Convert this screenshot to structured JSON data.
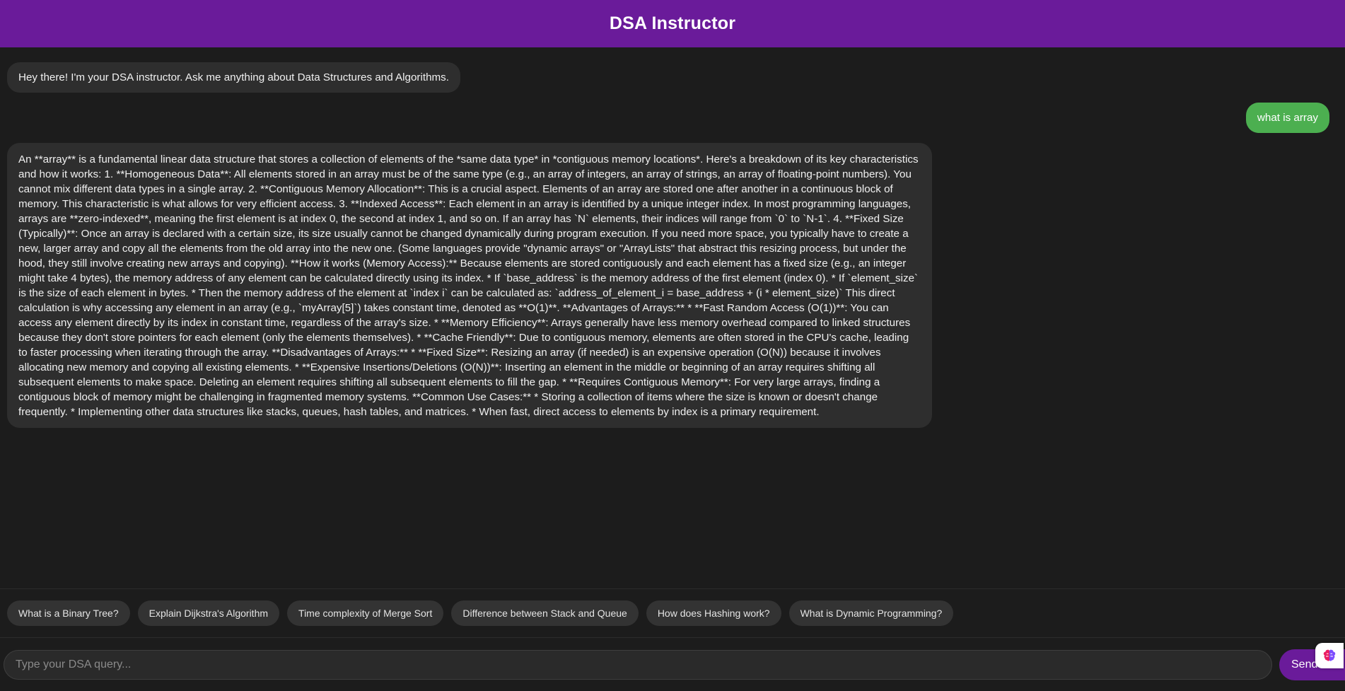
{
  "header": {
    "title": "DSA Instructor"
  },
  "messages": {
    "greeting": "Hey there! I'm your DSA instructor. Ask me anything about Data Structures and Algorithms.",
    "user_query": "what is array",
    "answer": "An **array** is a fundamental linear data structure that stores a collection of elements of the *same data type* in *contiguous memory locations*. Here's a breakdown of its key characteristics and how it works: 1. **Homogeneous Data**: All elements stored in an array must be of the same type (e.g., an array of integers, an array of strings, an array of floating-point numbers). You cannot mix different data types in a single array. 2. **Contiguous Memory Allocation**: This is a crucial aspect. Elements of an array are stored one after another in a continuous block of memory. This characteristic is what allows for very efficient access. 3. **Indexed Access**: Each element in an array is identified by a unique integer index. In most programming languages, arrays are **zero-indexed**, meaning the first element is at index 0, the second at index 1, and so on. If an array has `N` elements, their indices will range from `0` to `N-1`. 4. **Fixed Size (Typically)**: Once an array is declared with a certain size, its size usually cannot be changed dynamically during program execution. If you need more space, you typically have to create a new, larger array and copy all the elements from the old array into the new one. (Some languages provide \"dynamic arrays\" or \"ArrayLists\" that abstract this resizing process, but under the hood, they still involve creating new arrays and copying). **How it works (Memory Access):** Because elements are stored contiguously and each element has a fixed size (e.g., an integer might take 4 bytes), the memory address of any element can be calculated directly using its index. * If `base_address` is the memory address of the first element (index 0). * If `element_size` is the size of each element in bytes. * Then the memory address of the element at `index i` can be calculated as: `address_of_element_i = base_address + (i * element_size)` This direct calculation is why accessing any element in an array (e.g., `myArray[5]`) takes constant time, denoted as **O(1)**. **Advantages of Arrays:** * **Fast Random Access (O(1))**: You can access any element directly by its index in constant time, regardless of the array's size. * **Memory Efficiency**: Arrays generally have less memory overhead compared to linked structures because they don't store pointers for each element (only the elements themselves). * **Cache Friendly**: Due to contiguous memory, elements are often stored in the CPU's cache, leading to faster processing when iterating through the array. **Disadvantages of Arrays:** * **Fixed Size**: Resizing an array (if needed) is an expensive operation (O(N)) because it involves allocating new memory and copying all existing elements. * **Expensive Insertions/Deletions (O(N))**: Inserting an element in the middle or beginning of an array requires shifting all subsequent elements to make space. Deleting an element requires shifting all subsequent elements to fill the gap. * **Requires Contiguous Memory**: For very large arrays, finding a contiguous block of memory might be challenging in fragmented memory systems. **Common Use Cases:** * Storing a collection of items where the size is known or doesn't change frequently. * Implementing other data structures like stacks, queues, hash tables, and matrices. * When fast, direct access to elements by index is a primary requirement."
  },
  "suggestions": [
    "What is a Binary Tree?",
    "Explain Dijkstra's Algorithm",
    "Time complexity of Merge Sort",
    "Difference between Stack and Queue",
    "How does Hashing work?",
    "What is Dynamic Programming?"
  ],
  "input": {
    "placeholder": "Type your DSA query...",
    "value": ""
  },
  "send_button": {
    "label": "Send"
  },
  "colors": {
    "header": "#6a1b9a",
    "user_bubble": "#4caf50",
    "bot_bubble": "#2e2e2e",
    "background": "#1c1c1c",
    "send_button": "#6a1b9a"
  },
  "icons": {
    "widget": "brain-icon"
  }
}
